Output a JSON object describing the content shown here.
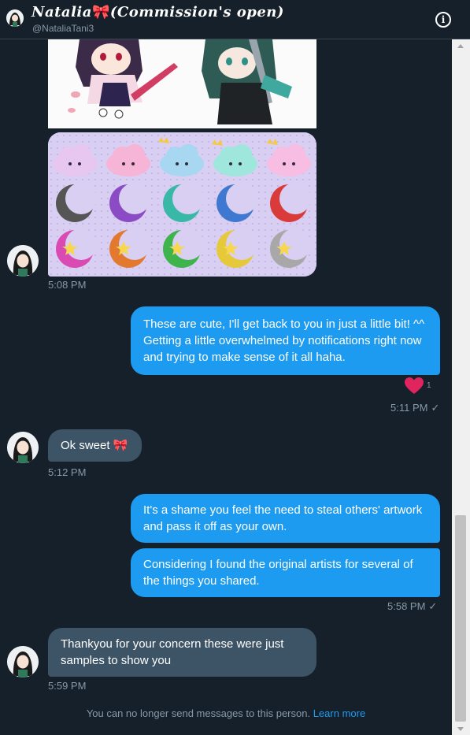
{
  "header": {
    "name": "Natalia",
    "name_emoji": "🎀",
    "name_suffix": "(Commission's open)",
    "handle": "@NataliaTani3",
    "info_icon": "info-icon"
  },
  "messages": [
    {
      "id": "m1",
      "direction": "in",
      "type": "images",
      "time": "5:08 PM"
    },
    {
      "id": "m2",
      "direction": "out",
      "text": "These are cute, I'll get back to you in just a little bit! ^^ Getting a little overwhelmed by notifications right now and trying to make sense of it all haha.",
      "reaction": {
        "icon": "heart-icon",
        "count": "1"
      },
      "time": "5:11 PM"
    },
    {
      "id": "m3",
      "direction": "in",
      "text": "Ok sweet 🎀",
      "time": "5:12 PM"
    },
    {
      "id": "m4",
      "direction": "out",
      "text": "It's a shame you feel the need to steal others' artwork and pass it off as your own."
    },
    {
      "id": "m5",
      "direction": "out",
      "text": "Considering I found the original artists for several of the things you shared.",
      "time": "5:58 PM"
    },
    {
      "id": "m6",
      "direction": "in",
      "text": "Thankyou for your concern these were just samples to show you",
      "time": "5:59 PM"
    }
  ],
  "footer": {
    "text": "You can no longer send messages to this person.",
    "link": "Learn more"
  },
  "colors": {
    "background": "#15202b",
    "outgoing_bubble": "#1d9bf0",
    "incoming_bubble": "#3d5466",
    "muted_text": "#8899a6",
    "reaction_heart": "#e0245e"
  }
}
